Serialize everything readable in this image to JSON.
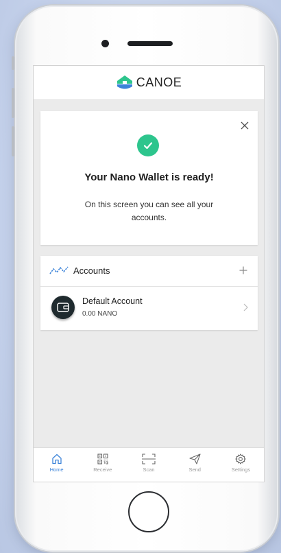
{
  "app": {
    "logo_text": "CANOE",
    "brand_colors": {
      "logo_green": "#2dc58d",
      "logo_blue": "#3b83d9"
    }
  },
  "welcome_card": {
    "title": "Your Nano Wallet is ready!",
    "body": "On this screen you can see all your accounts.",
    "icons": {
      "close": "close-icon",
      "status": "check-circle-icon"
    },
    "success_color": "#2dc58d"
  },
  "accounts": {
    "title": "Accounts",
    "icons": {
      "header": "nano-wave-icon",
      "add": "plus-icon"
    },
    "items": [
      {
        "name": "Default Account",
        "balance": "0.00 NANO",
        "icon": "wallet-icon"
      }
    ]
  },
  "tabs": [
    {
      "label": "Home",
      "icon": "home-icon",
      "active": true
    },
    {
      "label": "Receive",
      "icon": "qr-code-icon",
      "active": false
    },
    {
      "label": "Scan",
      "icon": "scan-icon",
      "active": false
    },
    {
      "label": "Send",
      "icon": "send-icon",
      "active": false
    },
    {
      "label": "Settings",
      "icon": "gear-icon",
      "active": false
    }
  ],
  "colors": {
    "active_tab": "#3b83d9",
    "inactive_tab": "#9a9a9a"
  }
}
